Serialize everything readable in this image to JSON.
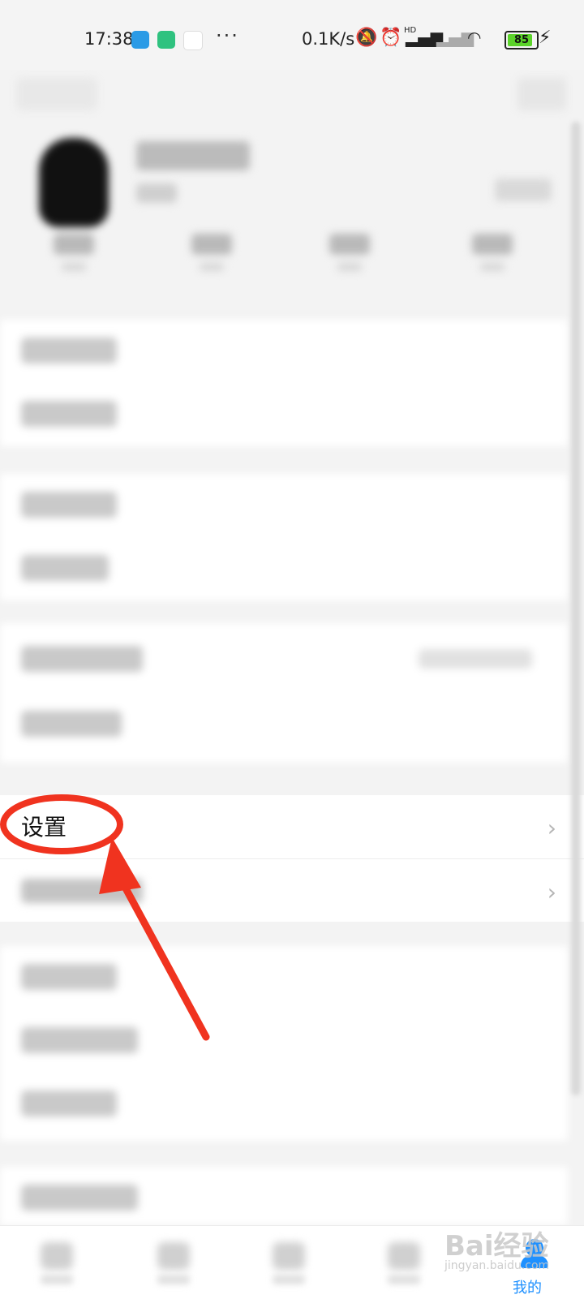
{
  "status_bar": {
    "time": "17:38",
    "more": "···",
    "net_speed": "0.1K/s",
    "battery": "85",
    "network_badge": "HD",
    "icons": [
      "telegram-icon",
      "shield-app-icon",
      "sina-icon",
      "mute-icon",
      "alarm-icon",
      "signal-icon",
      "no-signal-icon",
      "wifi-icon",
      "battery-icon",
      "charging-icon"
    ]
  },
  "settings_row": {
    "label": "设置"
  },
  "tab_bar": {
    "mine_label": "我的",
    "active_color": "#1e90ff"
  },
  "watermark": {
    "text": "Bai经验",
    "sub": "jingyan.baidu.com"
  },
  "annotation": {
    "color": "#f0331f"
  }
}
